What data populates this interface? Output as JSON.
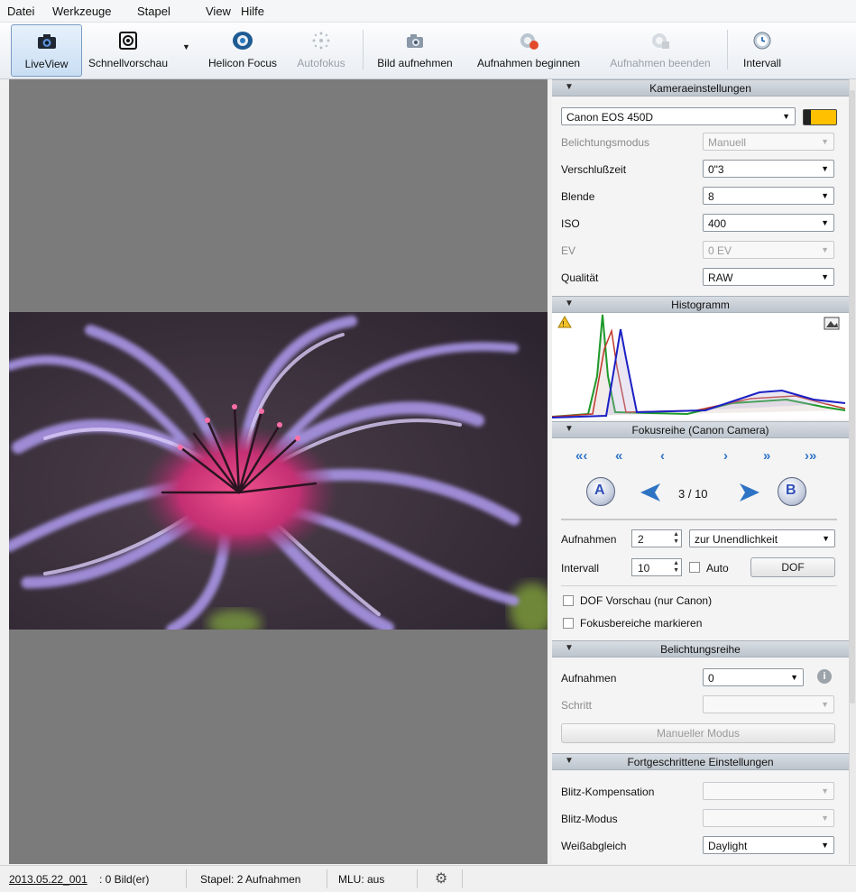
{
  "menu": [
    "Datei",
    "Werkzeuge",
    "Stapel",
    "View",
    "Hilfe"
  ],
  "toolbar": {
    "liveview": "LiveView",
    "schnellvorschau": "Schnellvorschau",
    "helicon": "Helicon Focus",
    "autofokus": "Autofokus",
    "bild_aufnehmen": "Bild aufnehmen",
    "aufnahmen_beginnen": "Aufnahmen beginnen",
    "aufnahmen_beenden": "Aufnahmen beenden",
    "intervall": "Intervall"
  },
  "kamera": {
    "title": "Kameraeinstellungen",
    "camera": "Canon EOS 450D",
    "rows": [
      {
        "label": "Belichtungsmodus",
        "value": "Manuell",
        "disabled": true
      },
      {
        "label": "Verschlußzeit",
        "value": "0\"3",
        "disabled": false
      },
      {
        "label": "Blende",
        "value": "8",
        "disabled": false
      },
      {
        "label": "ISO",
        "value": "400",
        "disabled": false
      },
      {
        "label": "EV",
        "value": "0 EV",
        "disabled": true
      },
      {
        "label": "Qualität",
        "value": "RAW",
        "disabled": false
      }
    ]
  },
  "histogramm": {
    "title": "Histogramm"
  },
  "fokus": {
    "title": "Fokusreihe (Canon Camera)",
    "position": "3 / 10",
    "aufnahmen_label": "Aufnahmen",
    "aufnahmen_value": "2",
    "direction": "zur Unendlichkeit",
    "intervall_label": "Intervall",
    "intervall_value": "10",
    "auto_label": "Auto",
    "dof_button": "DOF",
    "dof_preview": "DOF Vorschau (nur Canon)",
    "mark_areas": "Fokusbereiche markieren"
  },
  "belichtungsreihe": {
    "title": "Belichtungsreihe",
    "aufnahmen_label": "Aufnahmen",
    "aufnahmen_value": "0",
    "schritt_label": "Schritt",
    "manual_button": "Manueller Modus"
  },
  "fortgeschritten": {
    "title": "Fortgeschrittene Einstellungen",
    "blitz_komp": "Blitz-Kompensation",
    "blitz_modus": "Blitz-Modus",
    "weiss": "Weißabgleich",
    "weiss_value": "Daylight"
  },
  "status": {
    "session": "2013.05.22_001",
    "images": ": 0 Bild(er)",
    "stapel": "Stapel: 2 Aufnahmen",
    "mlu": "MLU: aus"
  }
}
